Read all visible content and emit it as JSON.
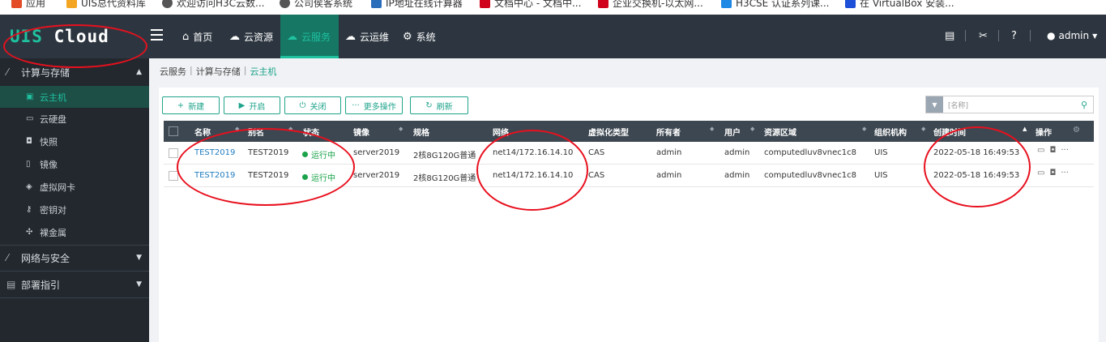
{
  "bookmarks": [
    {
      "label": "应用",
      "color": "#e34c26"
    },
    {
      "label": "UIS总代资料库",
      "color": "#f4a623"
    },
    {
      "label": "欢迎访问H3C云数...",
      "color": "#555555"
    },
    {
      "label": "公司侯客系统",
      "color": "#555555"
    },
    {
      "label": "IP地址在线计算器",
      "color": "#2a6ebb"
    },
    {
      "label": "文档中心 - 文档中...",
      "color": "#d0021b"
    },
    {
      "label": "企业交换机-以太网...",
      "color": "#d0021b"
    },
    {
      "label": "H3CSE 认证系列课...",
      "color": "#1e88e5"
    },
    {
      "label": "在 VirtualBox 安装...",
      "color": "#1e4fd8"
    }
  ],
  "logo": {
    "part1": "UIS",
    "part2": "Cloud"
  },
  "nav": {
    "tabs": [
      {
        "label": "首页",
        "icon": "home-icon"
      },
      {
        "label": "云资源",
        "icon": "cloud-icon"
      },
      {
        "label": "云服务",
        "icon": "cloud-icon"
      },
      {
        "label": "云运维",
        "icon": "cloud-icon"
      },
      {
        "label": "系统",
        "icon": "gear-icon"
      }
    ],
    "active_tab": "云服务",
    "user": "admin"
  },
  "sidebar": {
    "groups": [
      {
        "label": "计算与存储",
        "icon": "percent-icon",
        "expanded": true
      },
      {
        "label": "网络与安全",
        "icon": "percent-icon",
        "expanded": false
      },
      {
        "label": "部署指引",
        "icon": "book-icon",
        "expanded": false
      }
    ],
    "items": [
      {
        "label": "云主机",
        "icon": "server-icon",
        "active": true
      },
      {
        "label": "云硬盘",
        "icon": "disk-icon"
      },
      {
        "label": "快照",
        "icon": "camera-icon"
      },
      {
        "label": "镜像",
        "icon": "image-icon"
      },
      {
        "label": "虚拟网卡",
        "icon": "nic-icon"
      },
      {
        "label": "密钥对",
        "icon": "key-icon"
      },
      {
        "label": "裸金属",
        "icon": "baremetal-icon"
      }
    ]
  },
  "breadcrumb": [
    "云服务",
    "计算与存储",
    "云主机"
  ],
  "toolbar": {
    "buttons": [
      {
        "label": "新建",
        "icon": "plus-icon"
      },
      {
        "label": "开启",
        "icon": "play-icon"
      },
      {
        "label": "关闭",
        "icon": "power-icon"
      },
      {
        "label": "更多操作",
        "icon": "more-icon"
      },
      {
        "label": "刷新",
        "icon": "refresh-icon"
      }
    ],
    "search_placeholder": "[名称]"
  },
  "table": {
    "columns": [
      "名称",
      "别名",
      "状态",
      "镜像",
      "规格",
      "网络",
      "虚拟化类型",
      "所有者",
      "用户",
      "资源区域",
      "组织机构",
      "创建时间",
      "操作"
    ],
    "rows": [
      [
        "TEST2019",
        "TEST2019",
        "运行中",
        "server2019",
        "2核8G120G普通",
        "net14/172.16.14.10",
        "CAS",
        "admin",
        "admin",
        "computedluv8vnec1c8",
        "UIS",
        "2022-05-18 16:49:53"
      ],
      [
        "TEST2019",
        "TEST2019",
        "运行中",
        "server2019",
        "2核8G120G普通",
        "net14/172.16.14.10",
        "CAS",
        "admin",
        "admin",
        "computedluv8vnec1c8",
        "UIS",
        "2022-05-18 16:49:53"
      ]
    ]
  },
  "colors": {
    "accent": "#1fc19f",
    "nav_bg": "#2d3640",
    "sidebar_bg": "#22282e",
    "annotation": "#e8101e"
  }
}
